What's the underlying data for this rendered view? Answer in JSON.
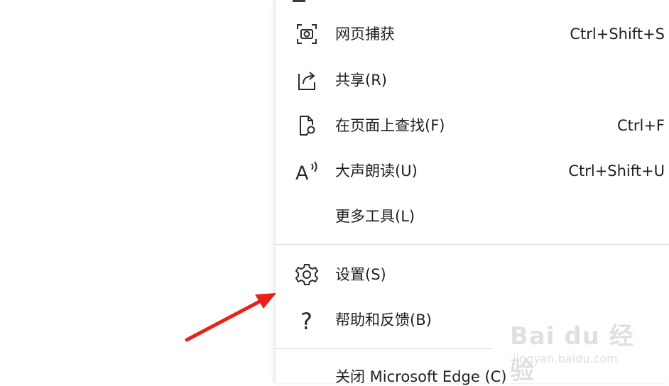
{
  "menu": {
    "items": [
      {
        "label": "网页捕获",
        "shortcut": "Ctrl+Shift+S",
        "icon": "web-capture-icon"
      },
      {
        "label": "共享(R)",
        "shortcut": "",
        "icon": "share-icon"
      },
      {
        "label": "在页面上查找(F)",
        "shortcut": "Ctrl+F",
        "icon": "find-on-page-icon"
      },
      {
        "label": "大声朗读(U)",
        "shortcut": "Ctrl+Shift+U",
        "icon": "read-aloud-icon"
      },
      {
        "label": "更多工具(L)",
        "shortcut": "",
        "icon": ""
      },
      {
        "label": "设置(S)",
        "shortcut": "",
        "icon": "gear-icon"
      },
      {
        "label": "帮助和反馈(B)",
        "shortcut": "",
        "icon": "help-icon"
      },
      {
        "label": "关闭 Microsoft Edge (C)",
        "shortcut": "",
        "icon": ""
      }
    ]
  },
  "icons": {
    "read_aloud_glyph": "A",
    "help_glyph": "?"
  },
  "watermark": {
    "logo": "Bai du 经验",
    "url": "jingyan.baidu.com"
  },
  "colors": {
    "arrow": "#e8221b",
    "text": "#1f1f1f",
    "divider": "#dcdcdc"
  }
}
